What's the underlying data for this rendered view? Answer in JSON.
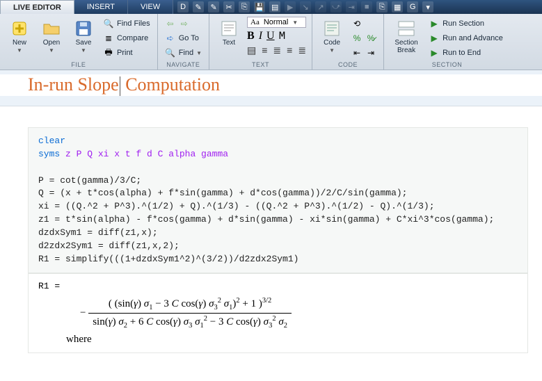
{
  "tabs": {
    "live_editor": "LIVE EDITOR",
    "insert": "INSERT",
    "view": "VIEW"
  },
  "groups": {
    "file": "FILE",
    "navigate": "NAVIGATE",
    "text": "TEXT",
    "code": "CODE",
    "section_hdr": "SECTION",
    "new": "New",
    "open": "Open",
    "save": "Save",
    "find_files": "Find Files",
    "compare": "Compare",
    "print": "Print",
    "goto": "Go To",
    "find": "Find",
    "text_btn": "Text",
    "normal": "Normal",
    "code_btn": "Code",
    "section": "Section\nBreak",
    "run_section": "Run Section",
    "run_advance": "Run and Advance",
    "run_end": "Run to End"
  },
  "doc": {
    "title_a": "In-run Slope",
    "title_b": " Computation",
    "line1a": "clear",
    "line2a": "syms ",
    "line2b": "z P Q xi x t f d C alpha gamma",
    "line3": "P = cot(gamma)/3/C;",
    "line4": "Q = (x + t*cos(alpha) + f*sin(gamma) + d*cos(gamma))/2/C/sin(gamma);",
    "line5": "xi = ((Q.^2 + P^3).^(1/2) + Q).^(1/3) - ((Q.^2 + P^3).^(1/2) - Q).^(1/3);",
    "line6": "z1 = t*sin(alpha) - f*cos(gamma) + d*sin(gamma) - xi*sin(gamma) + C*xi^3*cos(gamma);",
    "line7": "dzdxSym1 = diff(z1,x);",
    "line8": "d2zdx2Sym1 = diff(z1,x,2);",
    "line9": "R1 = simplify(((1+dzdxSym1^2)^(3/2))/d2zdx2Sym1)",
    "out_label": "R1 =",
    "where": "where"
  }
}
